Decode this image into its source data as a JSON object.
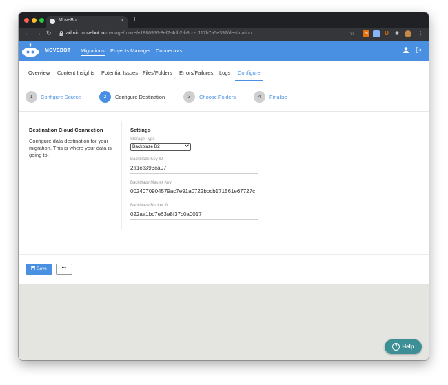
{
  "browser": {
    "tab_title": "MoveBot",
    "tab_close": "×",
    "new_tab": "+",
    "url_host": "admin.movebot.io",
    "url_path": "/manage/move/e1886956-8ef2-4db2-b8cc-c117b7a5e392/destination",
    "back": "←",
    "forward": "→",
    "reload": "↻",
    "lock": "🔒",
    "star": "☆",
    "ext_badge": "28",
    "menu": "⋮"
  },
  "header": {
    "brand": "MOVEBOT",
    "nav": [
      "Migrations",
      "Projects Manager",
      "Connectors"
    ],
    "user_icon": "👤",
    "logout_icon": "⇥"
  },
  "subnav": {
    "items": [
      "Overview",
      "Content Insights",
      "Potential Issues",
      "Files/Folders",
      "Errors/Failures",
      "Logs",
      "Configure"
    ],
    "active": "Configure"
  },
  "stepper": {
    "steps": [
      {
        "num": "1",
        "label": "Configure Source"
      },
      {
        "num": "2",
        "label": "Configure Destination"
      },
      {
        "num": "3",
        "label": "Choose Folders"
      },
      {
        "num": "4",
        "label": "Finalise"
      }
    ]
  },
  "left": {
    "title": "Destination Cloud Connection",
    "description": "Configure data destination for your migration. This is where your data is going to."
  },
  "settings": {
    "title": "Settings",
    "storage_type_label": "Storage Type",
    "storage_type_value": "Backblaze B2",
    "key_id_label": "Backblaze Key ID",
    "key_id_value": "2a1ce393ca07",
    "master_key_label": "Backblaze Master Key",
    "master_key_value": "0024070904579ac7e91a0722bbcb171561e67727c",
    "bucket_id_label": "Backblaze Bucket ID",
    "bucket_id_value": "022aa1bc7e63e8f37c0a0017"
  },
  "actions": {
    "save": "Save",
    "more": "···"
  },
  "help": {
    "label": "Help",
    "icon": "?"
  },
  "colors": {
    "accent": "#4a90e2",
    "help": "#3d8f96"
  }
}
